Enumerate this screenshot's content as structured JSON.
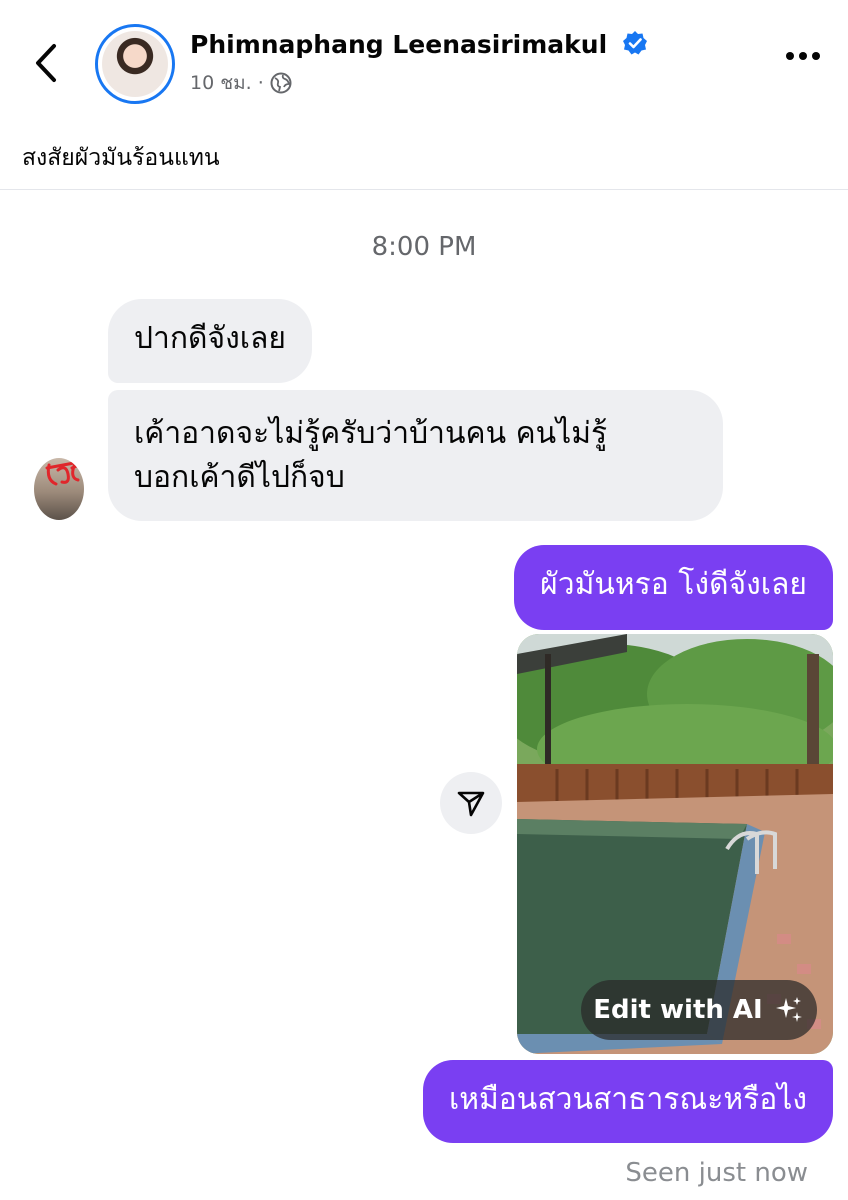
{
  "post": {
    "author_name": "Phimnaphang Leenasirimakul",
    "time": "10 ชม.",
    "separator": "·",
    "caption": "สงสัยผัวมันร้อนแทน"
  },
  "chat": {
    "timestamp": "8:00 PM",
    "incoming": [
      "ปากดีจังเลย",
      "เค้าอาดจะไม่รู้ครับว่าบ้านคน คนไม่รู้",
      "บอกเค้าดีไปก็จบ"
    ],
    "outgoing": [
      "ผัวมันหรอ โง่ดีจังเลย",
      "เหมือนสวนสาธารณะหรือไง"
    ],
    "edit_ai_label": "Edit with AI",
    "seen_status": "Seen just now"
  },
  "icons": {
    "back": "chevron-left-icon",
    "verified": "verified-badge-icon",
    "privacy": "globe-icon",
    "more": "more-dots-icon",
    "share": "send-icon",
    "sparkle": "sparkle-icon"
  },
  "colors": {
    "outgoing_bubble": "#7a3ff2",
    "incoming_bubble": "#eeeff2",
    "verified": "#1877f2",
    "secondary_text": "#65676b"
  }
}
